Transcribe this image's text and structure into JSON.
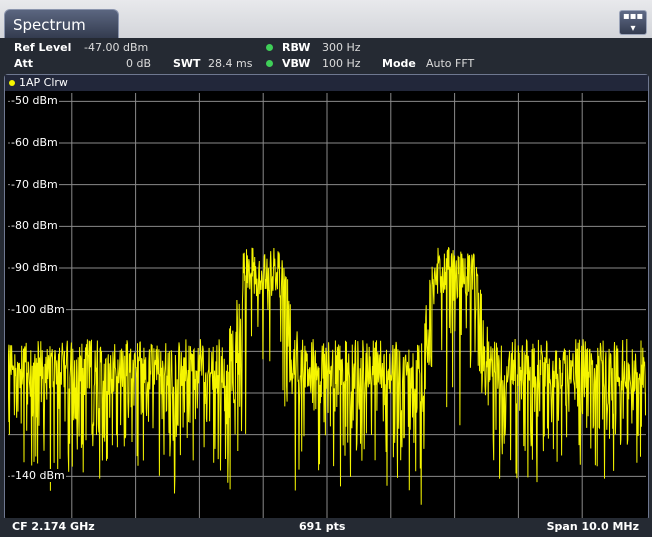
{
  "window": {
    "tab_title": "Spectrum",
    "menu_icon": "menu-icon"
  },
  "settings": {
    "ref_level_label": "Ref Level",
    "ref_level_value": "-47.00 dBm",
    "att_label": "Att",
    "att_value": "0 dB",
    "swt_label": "SWT",
    "swt_value": "28.4 ms",
    "rbw_label": "RBW",
    "rbw_value": "300 Hz",
    "vbw_label": "VBW",
    "vbw_value": "100 Hz",
    "mode_label": "Mode",
    "mode_value": "Auto FFT",
    "indicator_color": "#3fcf58"
  },
  "trace": {
    "label": "1AP Clrw",
    "color": "#f5f500"
  },
  "status": {
    "center_freq": "CF 2.174 GHz",
    "points": "691 pts",
    "span": "Span 10.0 MHz"
  },
  "chart_data": {
    "type": "line",
    "title": "",
    "xlabel": "",
    "ylabel": "",
    "y_tick_labels": [
      "-50 dBm",
      "-60 dBm",
      "-70 dBm",
      "-80 dBm",
      "-90 dBm",
      "-100 dBm",
      "-140 dBm"
    ],
    "y_ticks": [
      -50,
      -60,
      -70,
      -80,
      -90,
      -100,
      -110,
      -120,
      -130,
      -140
    ],
    "ylim": [
      -150,
      -48
    ],
    "xlim": [
      -5,
      5
    ],
    "x_unit": "MHz offset from CF",
    "grid": true,
    "series": [
      {
        "noise_floor_dbm": -113,
        "noise_floor_spread_dbm": [
          -150,
          -108
        ],
        "signals": [
          {
            "center_offset_mhz": -1.0,
            "width_mhz": 0.6,
            "peak_dbm": -85
          },
          {
            "center_offset_mhz": 2.0,
            "width_mhz": 0.6,
            "peak_dbm": -85
          }
        ]
      }
    ]
  }
}
